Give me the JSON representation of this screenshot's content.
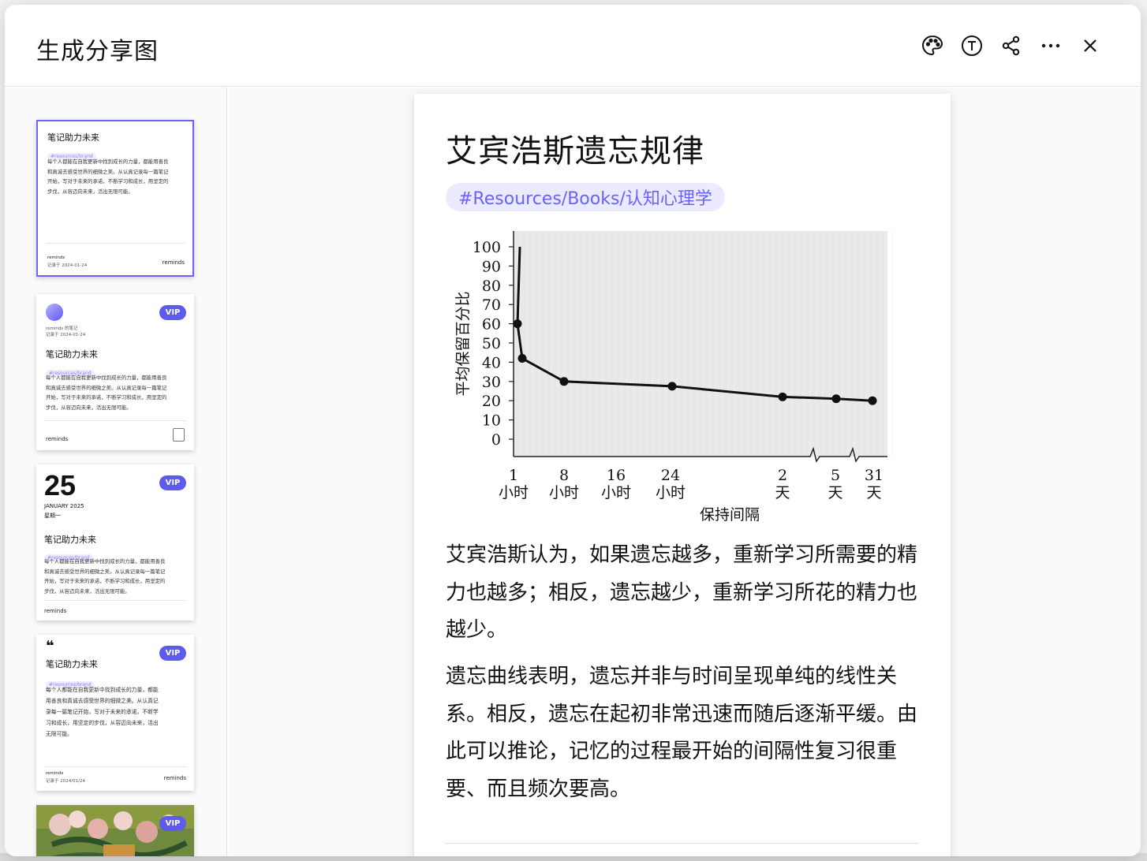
{
  "modal": {
    "title": "生成分享图"
  },
  "toolbar": {
    "icons": [
      "palette-icon",
      "text-icon",
      "share-icon",
      "more-icon",
      "close-icon"
    ]
  },
  "colors": {
    "accent": "#6c63ff",
    "vip": "#5d5aee",
    "tag_bg": "#eceaff",
    "tag_text": "#6a62ff"
  },
  "thumbnails": [
    {
      "title": "笔记助力未来",
      "tag": "#resources/brand",
      "body": [
        "每个人都能在自我更新中找到成长的力量，都能用善良",
        "和真诚去感受世界的细微之美。从认真记录每一篇笔记",
        "开始，写对于未来的承诺，不断学习和成长，用坚定的",
        "步伐，从容迈向未来，活出无限可能。"
      ],
      "footer_brand": "reminds",
      "footer_date": "记录于 2024-01-24",
      "footer_right": "reminds"
    },
    {
      "vip": "VIP",
      "author": "reminds 的笔记",
      "date": "记录于 2024-01-24",
      "title": "笔记助力未来",
      "tag": "#resources/brand",
      "body": [
        "每个人都能在自我更新中找到成长的力量，都能用善良",
        "和真诚去感受世界的细微之美。从认真记录每一篇笔记",
        "开始，写对于未来的承诺，不断学习和成长，用坚定的",
        "步伐，从容迈向未来，活出无限可能。"
      ],
      "footer_brand": "reminds"
    },
    {
      "vip": "VIP",
      "day": "25",
      "month": "JANUARY 2025",
      "weekday": "星期一",
      "title": "笔记助力未来",
      "tag": "#resources/brand",
      "body": [
        "每个人都能在自我更新中找到成长的力量，都能用善良",
        "和真诚去感受世界的细微之美。从认真记录每一篇笔记",
        "开始，写对于未来的承诺，不断学习和成长，用坚定的",
        "步伐，从容迈向未来，活出无限可能。"
      ],
      "footer_brand": "reminds"
    },
    {
      "vip": "VIP",
      "quote": "❝",
      "title": "笔记助力未来",
      "tag": "#resources/brand",
      "body": [
        "每个人都能在自我更新中找到成长的力量，都能",
        "用善良和真诚去感受世界的细微之美。从认真记",
        "录每一篇笔记开始，写对于未来的承诺，不断学",
        "习和成长，用坚定的步伐，从容迈向未来，活出",
        "无限可能。"
      ],
      "footer_brand": "reminds",
      "footer_date": "记录于 2024/01/24",
      "footer_right": "reminds"
    },
    {
      "vip": "VIP"
    }
  ],
  "card": {
    "title": "艾宾浩斯遗忘规律",
    "tag": "#Resources/Books/认知心理学",
    "paragraphs": [
      "艾宾浩斯认为，如果遗忘越多，重新学习所需要的精力也越多；相反，遗忘越少，重新学习所花的精力也越少。",
      "遗忘曲线表明，遗忘并非与时间呈现单纯的线性关系。相反，遗忘在起初非常迅速而随后逐渐平缓。由此可以推论，记忆的过程最开始的间隔性复习很重要、而且频次要高。"
    ]
  },
  "chart_data": {
    "type": "line",
    "ylabel": "平均保留百分比",
    "xlabel": "保持间隔",
    "ylim": [
      0,
      100
    ],
    "yticks": [
      "100",
      "90",
      "80",
      "70",
      "60",
      "50",
      "40",
      "30",
      "20",
      "10",
      "0"
    ],
    "xticks": [
      {
        "num": "1",
        "unit": "小时"
      },
      {
        "num": "8",
        "unit": "小时"
      },
      {
        "num": "16",
        "unit": "小时"
      },
      {
        "num": "24",
        "unit": "小时"
      },
      {
        "num": "2",
        "unit": "天"
      },
      {
        "num": "5",
        "unit": "天"
      },
      {
        "num": "31",
        "unit": "天"
      }
    ],
    "points": [
      {
        "x": "0 小时",
        "y": 100,
        "marker": false
      },
      {
        "x": "约0.3小时",
        "y": 60,
        "marker": true
      },
      {
        "x": "1 小时",
        "y": 42,
        "marker": true
      },
      {
        "x": "8 小时",
        "y": 30,
        "marker": true
      },
      {
        "x": "24 小时",
        "y": 27.5,
        "marker": true
      },
      {
        "x": "2 天",
        "y": 22,
        "marker": true
      },
      {
        "x": "5 天",
        "y": 21,
        "marker": true
      },
      {
        "x": "31 天",
        "y": 20,
        "marker": true
      }
    ],
    "grid": false
  }
}
